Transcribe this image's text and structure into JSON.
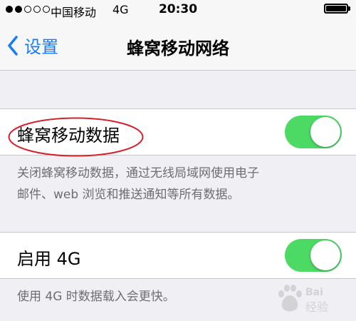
{
  "status_bar": {
    "signal_strength": 2,
    "signal_total": 5,
    "carrier": "中国移动",
    "network": "4G",
    "time": "20:30",
    "battery_level": 0.95
  },
  "nav": {
    "back_label": "设置",
    "title": "蜂窝移动网络"
  },
  "cellular_data": {
    "label": "蜂窝移动数据",
    "enabled": true,
    "footer_line1": "关闭蜂窝移动数据，通过无线局域网使用电子",
    "footer_line2": "邮件、web 浏览和推送通知等所有数据。"
  },
  "enable_4g": {
    "label": "启用 4G",
    "enabled": true,
    "footer": "使用 4G 时数据载入会更快。"
  },
  "colors": {
    "accent_blue": "#1a7cf5",
    "toggle_on": "#4cd964",
    "annotation_red": "#d6202a",
    "background": "#efeff4"
  },
  "watermark": {
    "brand": "Baidu",
    "suffix": "经验"
  }
}
